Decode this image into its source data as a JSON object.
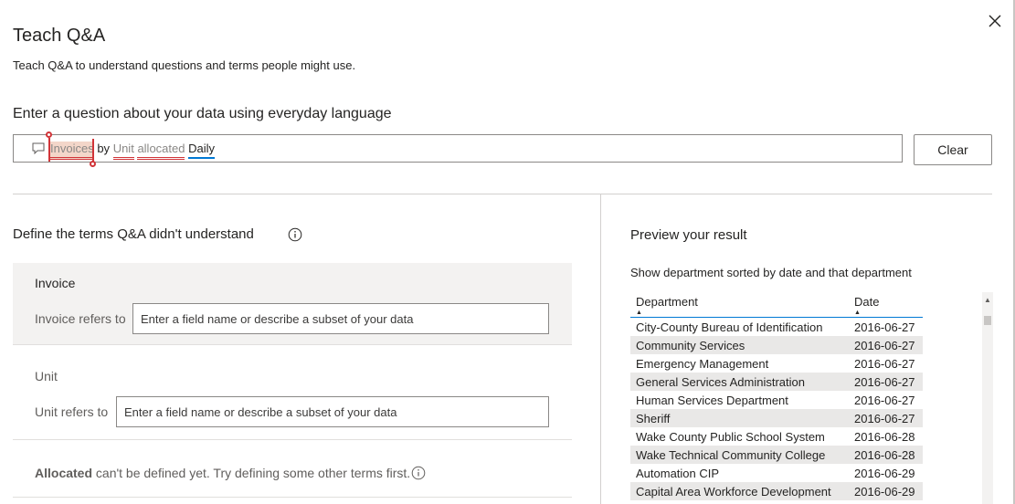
{
  "dialog": {
    "title": "Teach Q&A",
    "subtitle": "Teach Q&A to understand questions and terms people might use.",
    "close_icon": "close-icon"
  },
  "question": {
    "heading": "Enter a question about your data using everyday language",
    "tokens": {
      "t1": "Invoices",
      "t2": "by",
      "t3": "Unit",
      "t4": "allocated",
      "t5": "Daily"
    },
    "clear_label": "Clear",
    "colors": {
      "unknown_underline": "#d13438",
      "known_underline": "#0078d4"
    }
  },
  "define": {
    "heading": "Define the terms Q&A didn't understand",
    "invoice": {
      "name": "Invoice",
      "refers_label": "Invoice refers to",
      "placeholder": "Enter a field name or describe a subset of your data"
    },
    "unit": {
      "name": "Unit",
      "refers_label": "Unit refers to",
      "placeholder": "Enter a field name or describe a subset of your data"
    },
    "allocated": {
      "term": "Allocated",
      "note": "can't be defined yet. Try defining some other terms first."
    }
  },
  "preview": {
    "heading": "Preview your result",
    "caption": "Show department sorted by date and that department",
    "columns": {
      "department": "Department",
      "date": "Date"
    },
    "rows": [
      {
        "department": "City-County Bureau of Identification",
        "date": "2016-06-27"
      },
      {
        "department": "Community Services",
        "date": "2016-06-27"
      },
      {
        "department": "Emergency Management",
        "date": "2016-06-27"
      },
      {
        "department": "General Services Administration",
        "date": "2016-06-27"
      },
      {
        "department": "Human Services Department",
        "date": "2016-06-27"
      },
      {
        "department": "Sheriff",
        "date": "2016-06-27"
      },
      {
        "department": "Wake County Public School System",
        "date": "2016-06-28"
      },
      {
        "department": "Wake Technical Community College",
        "date": "2016-06-28"
      },
      {
        "department": "Automation CIP",
        "date": "2016-06-29"
      },
      {
        "department": "Capital Area Workforce Development",
        "date": "2016-06-29"
      }
    ]
  }
}
